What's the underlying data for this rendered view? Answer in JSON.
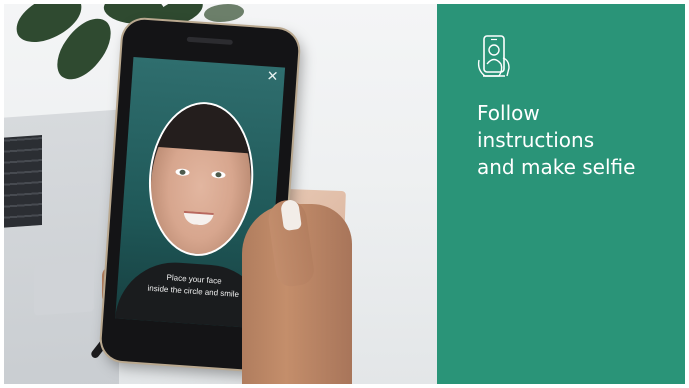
{
  "screen": {
    "close_glyph": "✕",
    "instruction_line1": "Place your face",
    "instruction_line2": "inside the circle and smile"
  },
  "panel": {
    "icon": "selfie-phone-icon",
    "headline_line1": "Follow",
    "headline_line2": "instructions",
    "headline_line3": "and make selfie",
    "background_color": "#2a9478",
    "text_color": "#ffffff"
  }
}
